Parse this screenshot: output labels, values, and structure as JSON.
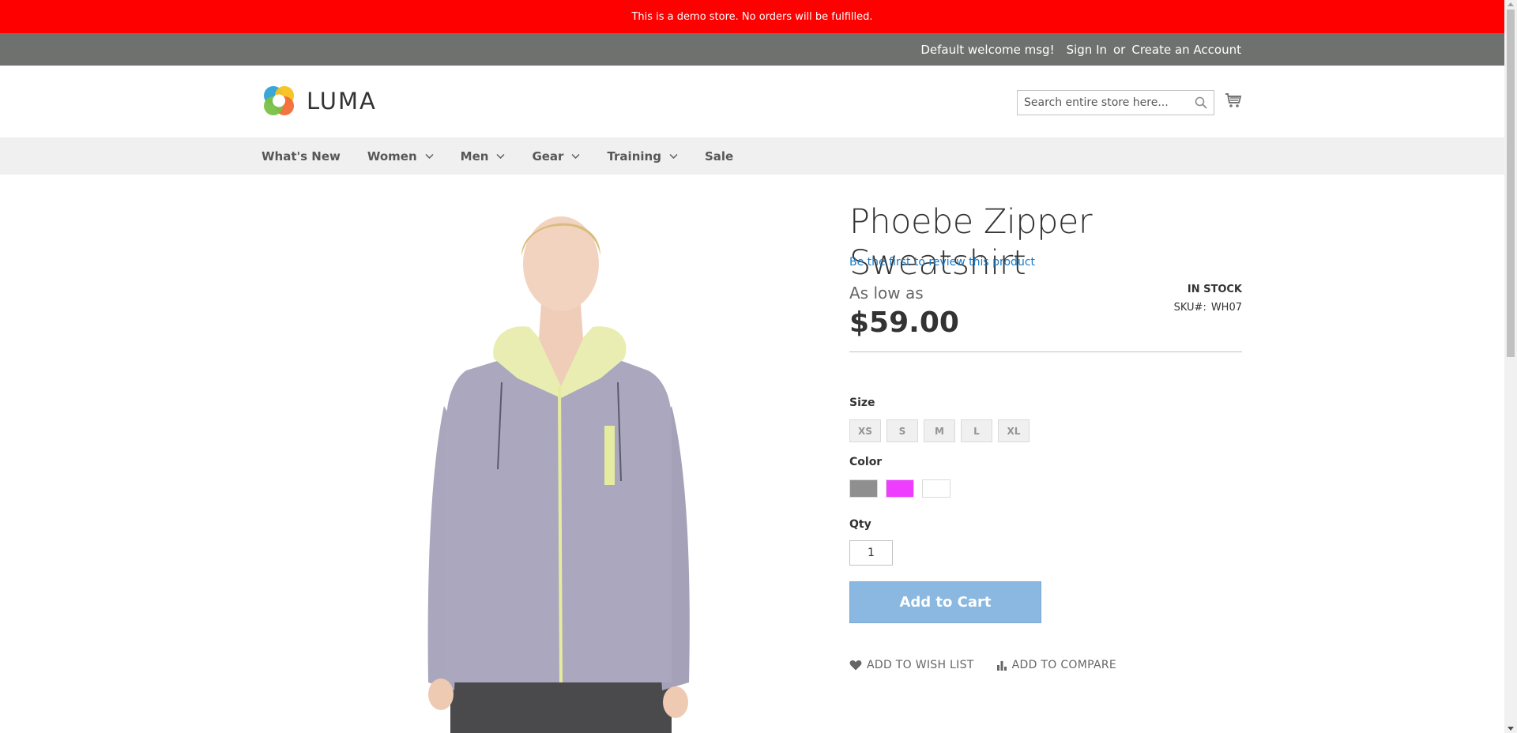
{
  "notice": {
    "text": "This is a demo store. No orders will be fulfilled."
  },
  "header": {
    "welcome": "Default welcome msg!",
    "sign_in": "Sign In",
    "or": "or",
    "create_account": "Create an Account"
  },
  "logo": {
    "text": "LUMA"
  },
  "search": {
    "placeholder": "Search entire store here..."
  },
  "nav": {
    "items": [
      {
        "label": "What's New"
      },
      {
        "label": "Women"
      },
      {
        "label": "Men"
      },
      {
        "label": "Gear"
      },
      {
        "label": "Training"
      },
      {
        "label": "Sale"
      }
    ]
  },
  "product": {
    "name": "Phoebe Zipper Sweatshirt",
    "review_link": "Be the first to review this product",
    "price_label": "As low as",
    "price": "$59.00",
    "stock": "In stock",
    "sku_label": "SKU#:",
    "sku": "WH07",
    "size_label": "Size",
    "sizes": [
      "XS",
      "S",
      "M",
      "L",
      "XL"
    ],
    "color_label": "Color",
    "colors": [
      "#8f8f8f",
      "#ef3dff",
      "#ffffff"
    ],
    "qty_label": "Qty",
    "qty": "1",
    "add_to_cart": "Add to Cart",
    "wish_list": "Add to Wish List",
    "compare": "Add to Compare"
  }
}
